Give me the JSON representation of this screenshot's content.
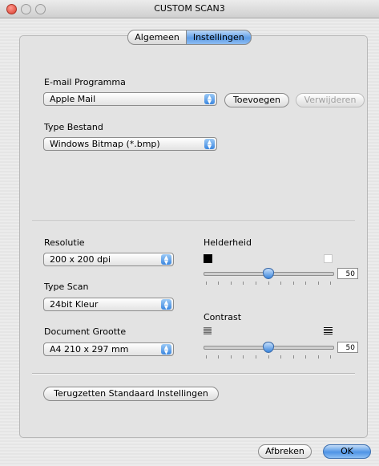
{
  "window": {
    "title": "CUSTOM SCAN3"
  },
  "tabs": [
    {
      "label": "Algemeen"
    },
    {
      "label": "Instellingen",
      "selected": true
    }
  ],
  "email": {
    "label": "E-mail Programma",
    "selected": "Apple Mail",
    "add_button": "Toevoegen",
    "remove_button": "Verwijderen"
  },
  "file_type": {
    "label": "Type Bestand",
    "selected": "Windows Bitmap (*.bmp)"
  },
  "resolution": {
    "label": "Resolutie",
    "selected": "200 x 200 dpi"
  },
  "scan_type": {
    "label": "Type Scan",
    "selected": "24bit Kleur"
  },
  "document_size": {
    "label": "Document Grootte",
    "selected": "A4 210 x 297 mm"
  },
  "brightness": {
    "label": "Helderheid",
    "value": "50",
    "min_icon": "black-square-icon",
    "max_icon": "white-square-icon"
  },
  "contrast": {
    "label": "Contrast",
    "value": "50",
    "min_icon": "low-contrast-icon",
    "max_icon": "high-contrast-icon"
  },
  "reset_button": "Terugzetten Standaard Instellingen",
  "footer": {
    "cancel": "Afbreken",
    "ok": "OK"
  },
  "colors": {
    "accent": "#5e9de7",
    "window": "#ececec"
  }
}
